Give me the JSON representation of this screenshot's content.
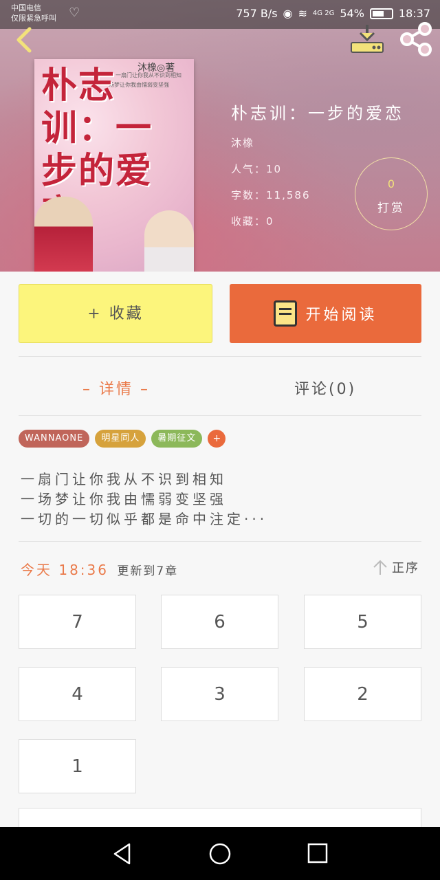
{
  "status_bar": {
    "carrier_line1": "中国电信",
    "carrier_line2": "仅限紧急呼叫",
    "speed": "757 B/s",
    "network": "4G 2G",
    "battery": "54%",
    "time": "18:37"
  },
  "book": {
    "title": "朴志训：一步的爱恋",
    "author": "沐橡",
    "popularity": "人气：10",
    "word_count": "字数：11,586",
    "favorites": "收藏：0",
    "tip_count": "0",
    "tip_label": "打赏"
  },
  "cover": {
    "author_line": "沐橡◎著",
    "tagline1": "一扇门让你我从不识到相知",
    "tagline2": "一场梦让你我由懦弱变坚强",
    "title_art": "朴志训：一步的爱恋"
  },
  "actions": {
    "collect_label": "+ 收藏",
    "read_label": "开始阅读"
  },
  "tabs": {
    "details": "– 详情 –",
    "comments": "评论(0)"
  },
  "tags": [
    {
      "label": "WANNAONE",
      "color": "#c0655a"
    },
    {
      "label": "明星同人",
      "color": "#d6a23c"
    },
    {
      "label": "暑期征文",
      "color": "#8cb85a"
    }
  ],
  "tag_add": "+",
  "description": [
    "一扇门让你我从不识到相知",
    "一场梦让你我由懦弱变坚强",
    "一切的一切似乎都是命中注定···"
  ],
  "update": {
    "time": "今天 18:36",
    "text": "更新到7章"
  },
  "order_label": "正序",
  "chapters": [
    "7",
    "6",
    "5",
    "4",
    "3",
    "2",
    "1"
  ],
  "colors": {
    "accent_orange": "#ea6a3c",
    "collect_yellow": "#fcf57c",
    "tip_gold": "#f1e17a"
  }
}
